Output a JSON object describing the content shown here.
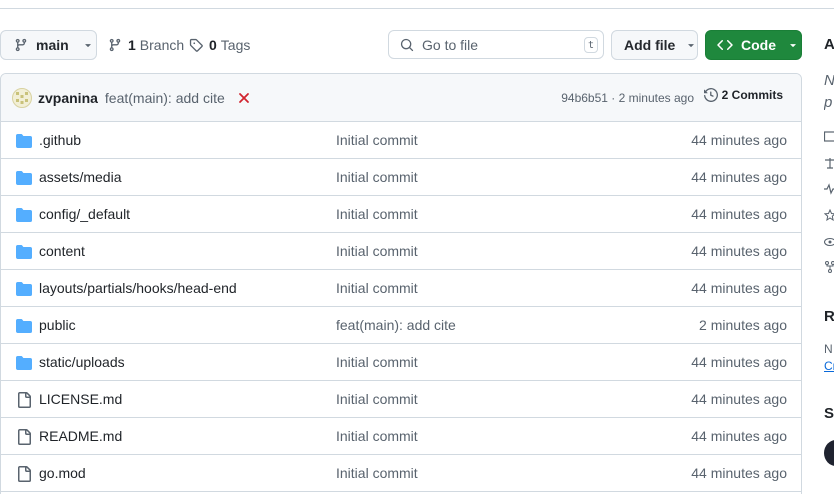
{
  "toolbar": {
    "branch_label": "main",
    "branch_count": "1",
    "branch_word": "Branch",
    "tag_count": "0",
    "tag_word": "Tags",
    "goto_placeholder": "Go to file",
    "goto_shortcut": "t",
    "add_file_label": "Add file",
    "code_label": "Code"
  },
  "latest_commit": {
    "author": "zvpanina",
    "message": "feat(main): add cite",
    "status": "failed",
    "hash": "94b6b51",
    "time": "2 minutes ago",
    "hash_time": "94b6b51 · 2 minutes ago",
    "commits_label": "2 Commits"
  },
  "files": [
    {
      "type": "folder",
      "name": ".github",
      "message": "Initial commit",
      "time": "44 minutes ago"
    },
    {
      "type": "folder",
      "name": "assets/media",
      "message": "Initial commit",
      "time": "44 minutes ago"
    },
    {
      "type": "folder",
      "name": "config/_default",
      "message": "Initial commit",
      "time": "44 minutes ago"
    },
    {
      "type": "folder",
      "name": "content",
      "message": "Initial commit",
      "time": "44 minutes ago"
    },
    {
      "type": "folder",
      "name": "layouts/partials/hooks/head-end",
      "message": "Initial commit",
      "time": "44 minutes ago"
    },
    {
      "type": "folder",
      "name": "public",
      "message": "feat(main): add cite",
      "time": "2 minutes ago"
    },
    {
      "type": "folder",
      "name": "static/uploads",
      "message": "Initial commit",
      "time": "44 minutes ago"
    },
    {
      "type": "file",
      "name": "LICENSE.md",
      "message": "Initial commit",
      "time": "44 minutes ago"
    },
    {
      "type": "file",
      "name": "README.md",
      "message": "Initial commit",
      "time": "44 minutes ago"
    },
    {
      "type": "file",
      "name": "go.mod",
      "message": "Initial commit",
      "time": "44 minutes ago"
    }
  ],
  "sidebar": {
    "about_heading": "A",
    "no_desc": "N",
    "no_desc_2": "p",
    "releases_heading": "R",
    "releases_text": "N",
    "releases_link": "Cr",
    "sponsors_heading": "S"
  },
  "colors": {
    "accent_green": "#1f883d",
    "folder_blue": "#54aeff",
    "fail_red": "#d1242f",
    "link_blue": "#0969da"
  },
  "icons": {
    "branch": "git-branch-icon",
    "tag": "tag-icon",
    "search": "search-icon",
    "code": "code-icon",
    "history": "history-icon",
    "folder": "folder-icon",
    "file": "file-icon"
  }
}
